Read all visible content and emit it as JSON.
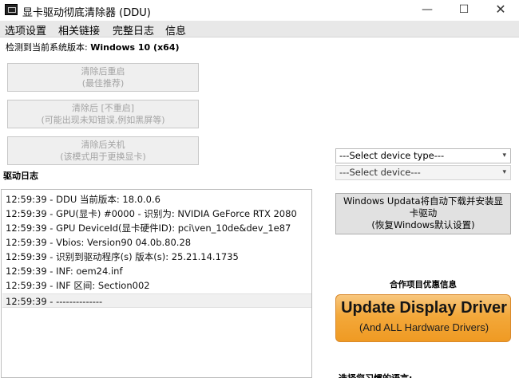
{
  "window": {
    "title": "显卡驱动彻底清除器 (DDU)",
    "min_glyph": "—",
    "max_glyph": "☐",
    "close_glyph": "✕"
  },
  "menu": {
    "items": [
      "选项设置",
      "相关链接",
      "完整日志",
      "信息"
    ]
  },
  "os_detect": {
    "label": "检测到当前系统版本: ",
    "value": "Windows 10 (x64)"
  },
  "actions": {
    "clean_restart": {
      "line1": "清除后重启",
      "line2": "(最佳推荐)"
    },
    "clean_no_restart": {
      "line1": "清除后 [不重启]",
      "line2": "(可能出现未知错误,例如黑屏等)"
    },
    "clean_shutdown": {
      "line1": "清除后关机",
      "line2": "(该模式用于更换显卡)"
    }
  },
  "log": {
    "title": "驱动日志",
    "lines": [
      "12:59:39 - DDU 当前版本: 18.0.0.6",
      "12:59:39 - GPU(显卡) #0000 - 识别为: NVIDIA GeForce RTX 2080",
      "12:59:39 - GPU DeviceId(显卡硬件ID): pci\\ven_10de&dev_1e87",
      "12:59:39 - Vbios: Version90 04.0b.80.28",
      "12:59:39 - 识别到驱动程序(s) 版本(s): 25.21.14.1735",
      "12:59:39 - INF: oem24.inf",
      "12:59:39 - INF 区间: Section002",
      "12:59:39 - --------------"
    ]
  },
  "device_type_select": {
    "value": "---Select device type---",
    "arrow": "▾"
  },
  "device_select": {
    "value": "---Select device---",
    "arrow": "▾"
  },
  "windows_update_button": {
    "line1": "Windows Updata将自动下载并安装显",
    "line2": "卡驱动",
    "line3": "(恢复Windows默认设置)"
  },
  "partner": {
    "title": "合作项目优惠信息",
    "ad_main": "Update Display Driver",
    "ad_sub": "(And ALL Hardware Drivers)",
    "ad_colors": {
      "top": "#f8c77e",
      "bottom": "#ef9a23"
    }
  },
  "cut_off_text": "选择您习惯的语言:"
}
